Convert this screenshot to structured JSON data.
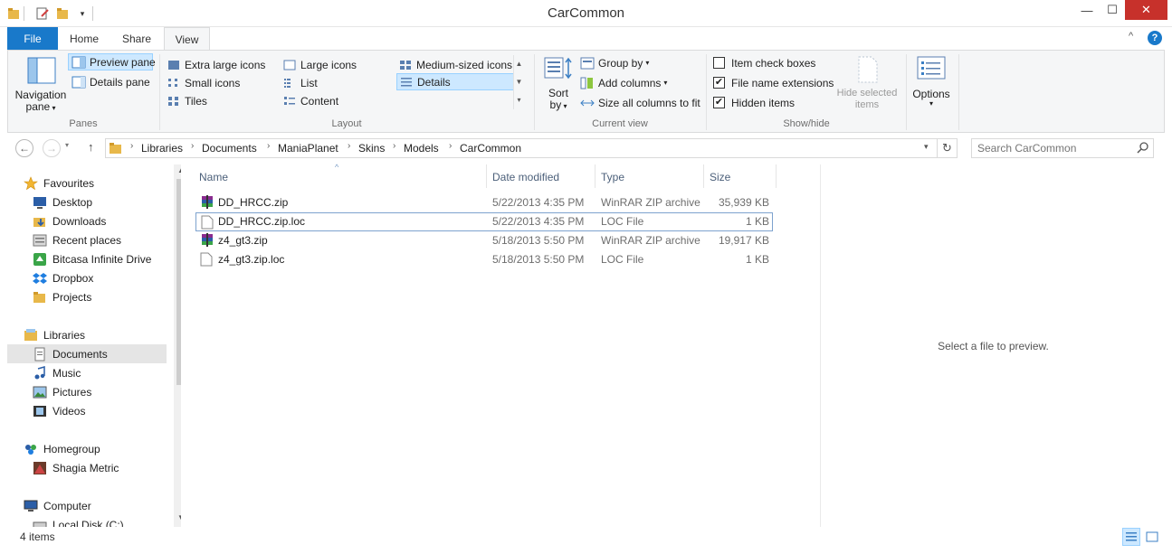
{
  "window": {
    "title": "CarCommon",
    "minimize_glyph": "—",
    "maximize_glyph": "☐",
    "close_glyph": "✕",
    "collapse_glyph": "^",
    "help_glyph": "?"
  },
  "tabs": {
    "file": "File",
    "home": "Home",
    "share": "Share",
    "view": "View"
  },
  "ribbon": {
    "panes": {
      "navigation_pane": "Navigation",
      "navigation_pane_2": "pane",
      "preview_pane": "Preview pane",
      "details_pane": "Details pane",
      "label": "Panes"
    },
    "layout": {
      "items": [
        "Extra large icons",
        "Large icons",
        "Medium-sized icons",
        "Small icons",
        "List",
        "Details",
        "Tiles",
        "Content"
      ],
      "selected": "Details",
      "label": "Layout"
    },
    "current_view": {
      "sort_by_1": "Sort",
      "sort_by_2": "by",
      "group_by": "Group by",
      "add_columns": "Add columns",
      "size_all_columns": "Size all columns to fit",
      "label": "Current view"
    },
    "show_hide": {
      "item_check_boxes": "Item check boxes",
      "file_name_extensions": "File name extensions",
      "hidden_items": "Hidden items",
      "item_check_boxes_checked": false,
      "file_name_extensions_checked": true,
      "hidden_items_checked": true,
      "hide_selected_1": "Hide selected",
      "hide_selected_2": "items",
      "label": "Show/hide"
    },
    "options": "Options"
  },
  "address": {
    "breadcrumbs": [
      "Libraries",
      "Documents",
      "ManiaPlanet",
      "Skins",
      "Models",
      "CarCommon"
    ]
  },
  "search": {
    "placeholder": "Search CarCommon"
  },
  "nav": {
    "favourites": "Favourites",
    "favourites_items": [
      "Desktop",
      "Downloads",
      "Recent places",
      "Bitcasa Infinite Drive",
      "Dropbox",
      "Projects"
    ],
    "libraries": "Libraries",
    "libraries_items": [
      "Documents",
      "Music",
      "Pictures",
      "Videos"
    ],
    "selected": "Documents",
    "homegroup": "Homegroup",
    "homegroup_items": [
      "Shagia Metric"
    ],
    "computer": "Computer",
    "computer_items": [
      "Local Disk (C:)"
    ]
  },
  "columns": {
    "name": "Name",
    "date_modified": "Date modified",
    "type": "Type",
    "size": "Size"
  },
  "files": [
    {
      "name": "DD_HRCC.zip",
      "date": "5/22/2013 4:35 PM",
      "type": "WinRAR ZIP archive",
      "size": "35,939 KB",
      "icon": "winrar-archive-icon"
    },
    {
      "name": "DD_HRCC.zip.loc",
      "date": "5/22/2013 4:35 PM",
      "type": "LOC File",
      "size": "1 KB",
      "icon": "file-icon"
    },
    {
      "name": "z4_gt3.zip",
      "date": "5/18/2013 5:50 PM",
      "type": "WinRAR ZIP archive",
      "size": "19,917 KB",
      "icon": "winrar-archive-icon"
    },
    {
      "name": "z4_gt3.zip.loc",
      "date": "5/18/2013 5:50 PM",
      "type": "LOC File",
      "size": "1 KB",
      "icon": "file-icon"
    }
  ],
  "focused_row": "DD_HRCC.zip.loc",
  "preview": {
    "message": "Select a file to preview."
  },
  "status": {
    "items_count": "4 items"
  },
  "colors": {
    "accent": "#1979ca",
    "selection": "#cde8ff",
    "folder": "#e8b84a"
  }
}
